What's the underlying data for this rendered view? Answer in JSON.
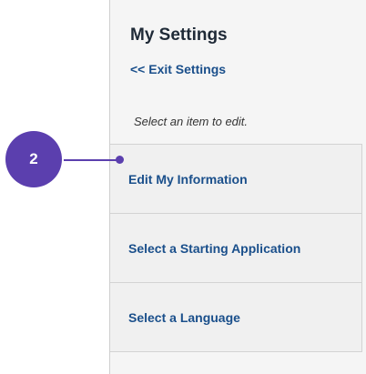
{
  "panel": {
    "title": "My Settings",
    "exit_link": "<< Exit Settings",
    "instruction": "Select an item to edit."
  },
  "menu": {
    "items": [
      {
        "label": "Edit My Information"
      },
      {
        "label": "Select a Starting Application"
      },
      {
        "label": "Select a Language"
      }
    ]
  },
  "callout": {
    "number": "2",
    "color": "#5b3fae"
  }
}
